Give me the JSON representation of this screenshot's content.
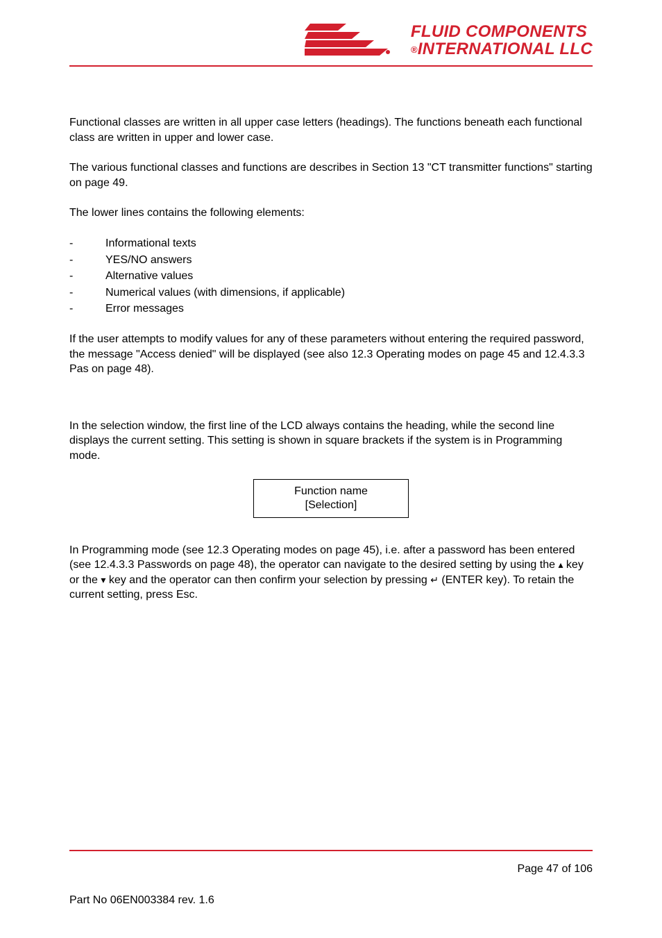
{
  "header": {
    "brand_line1": "FLUID COMPONENTS",
    "brand_line2": "INTERNATIONAL LLC",
    "reg_symbol": "®"
  },
  "content": {
    "p1": "Functional classes are written in all upper case letters (headings). The functions beneath each functional class are written in upper and lower case.",
    "p2": "The various functional classes and functions are describes in Section 13 \"CT transmitter functions\" starting on page 49.",
    "p3": "The lower lines contains the following elements:",
    "list": [
      "Informational texts",
      "YES/NO answers",
      "Alternative values",
      "Numerical values (with dimensions, if applicable)",
      "Error messages"
    ],
    "p4": "If the user attempts to modify values for any of these parameters without entering the required password, the message \"Access denied\" will be displayed (see also 12.3 Operating modes on page 45 and 12.4.3.3 Pas on page 48).",
    "p5": "In the selection window, the first line of the LCD always contains the heading, while the second line displays the current setting. This setting is shown in square brackets if the system is in Programming mode.",
    "lcd": {
      "line1": "Function name",
      "line2": "[Selection]"
    },
    "p6a": "In Programming mode (see 12.3 Operating modes on page 45), i.e. after a password has been entered (see 12.4.3.3 Passwords on page 48), the operator can navigate to the desired setting by using the ",
    "p6b": " key or the ",
    "p6c": " key and the operator can then confirm your selection by pressing  ",
    "p6d": " (ENTER key). To retain the current setting, press Esc.",
    "up_icon": "▴",
    "down_icon": "▾",
    "enter_icon": "↵"
  },
  "footer": {
    "page_label": "Page 47 of 106",
    "part_no": "Part No 06EN003384 rev. 1.6"
  }
}
